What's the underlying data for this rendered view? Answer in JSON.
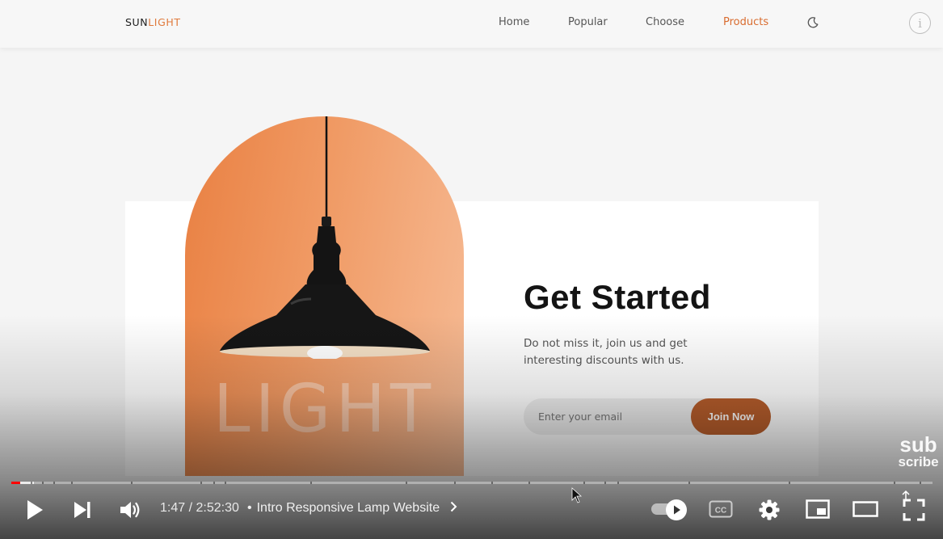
{
  "header": {
    "logo_part1": "SUN",
    "logo_part2": "LIGHT",
    "nav": [
      {
        "label": "Home"
      },
      {
        "label": "Popular"
      },
      {
        "label": "Choose"
      },
      {
        "label": "Products"
      }
    ],
    "active_nav": "Products",
    "theme_icon": "moon-icon",
    "info_label": "i"
  },
  "subscribe": {
    "arch_word": "LIGHT",
    "title": "Get Started",
    "description": "Do not miss it, join us and get interesting discounts with us.",
    "email_placeholder": "Enter your email",
    "button_label": "Join Now"
  },
  "watermark": {
    "line1": "sub",
    "line2": "scribe"
  },
  "player": {
    "current_time": "1:47",
    "separator": " / ",
    "duration": "2:52:30",
    "time_display": "1:47 / 2:52:30",
    "chapter_dot": "•",
    "chapter_title": "Intro Responsive Lamp Website",
    "played_fraction": 0.001,
    "icons": [
      "play-icon",
      "next-icon",
      "volume-icon",
      "autoplay-toggle-icon",
      "cc-icon",
      "settings-icon",
      "miniplayer-icon",
      "theater-icon",
      "fullscreen-icon"
    ]
  },
  "colors": {
    "accent": "#d96c2f",
    "join_button": "#b85e2c",
    "arch_start": "#e98042",
    "arch_end": "#f6bb95",
    "progress_played": "#ff0000"
  }
}
